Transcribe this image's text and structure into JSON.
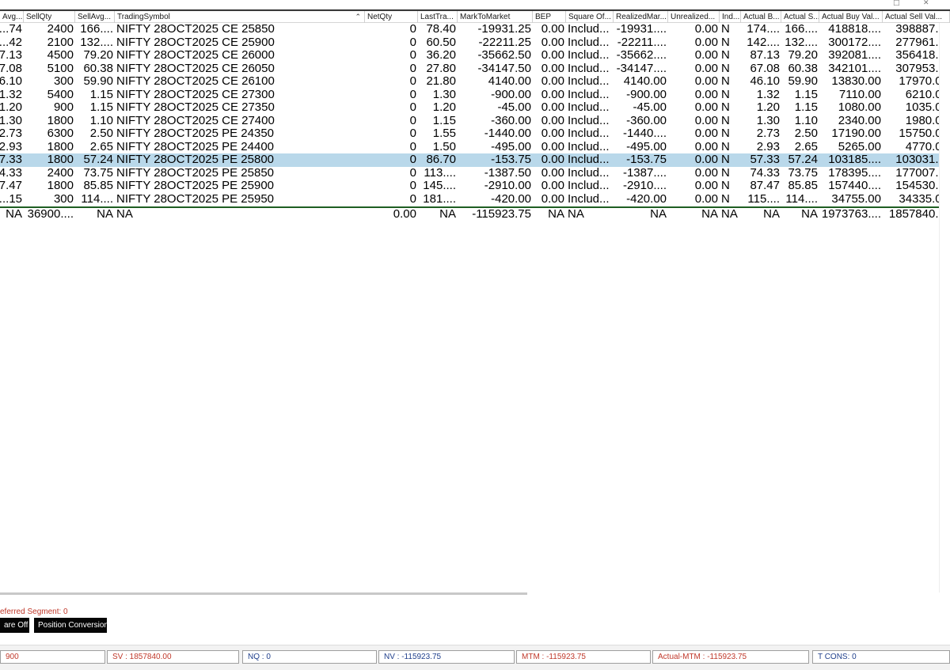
{
  "columns": [
    "Avg...",
    "SellQty",
    "SellAvg...",
    "TradingSymbol",
    "NetQty",
    "LastTra...",
    "MarkToMarket",
    "BEP",
    "Square Of...",
    "RealizedMar...",
    "Unrealized...",
    "Ind...",
    "Actual B...",
    "Actual S...",
    "Actual Buy Val...",
    "Actual Sell Val..."
  ],
  "rows": [
    [
      "74....",
      "2400",
      "166....",
      "NIFTY 28OCT2025 CE 25850",
      "0",
      "78.40",
      "-19931.25",
      "0.00",
      "Includ...",
      "-19931....",
      "0.00",
      "N",
      "174....",
      "166....",
      "418818....",
      "398887...."
    ],
    [
      "42....",
      "2100",
      "132....",
      "NIFTY 28OCT2025 CE 25900",
      "0",
      "60.50",
      "-22211.25",
      "0.00",
      "Includ...",
      "-22211....",
      "0.00",
      "N",
      "142....",
      "132....",
      "300172....",
      "277961...."
    ],
    [
      "7.13",
      "4500",
      "79.20",
      "NIFTY 28OCT2025 CE 26000",
      "0",
      "36.20",
      "-35662.50",
      "0.00",
      "Includ...",
      "-35662....",
      "0.00",
      "N",
      "87.13",
      "79.20",
      "392081....",
      "356418...."
    ],
    [
      "7.08",
      "5100",
      "60.38",
      "NIFTY 28OCT2025 CE 26050",
      "0",
      "27.80",
      "-34147.50",
      "0.00",
      "Includ...",
      "-34147....",
      "0.00",
      "N",
      "67.08",
      "60.38",
      "342101....",
      "307953...."
    ],
    [
      "6.10",
      "300",
      "59.90",
      "NIFTY 28OCT2025 CE 26100",
      "0",
      "21.80",
      "4140.00",
      "0.00",
      "Includ...",
      "4140.00",
      "0.00",
      "N",
      "46.10",
      "59.90",
      "13830.00",
      "17970.00"
    ],
    [
      "1.32",
      "5400",
      "1.15",
      "NIFTY 28OCT2025 CE 27300",
      "0",
      "1.30",
      "-900.00",
      "0.00",
      "Includ...",
      "-900.00",
      "0.00",
      "N",
      "1.32",
      "1.15",
      "7110.00",
      "6210.00"
    ],
    [
      "1.20",
      "900",
      "1.15",
      "NIFTY 28OCT2025 CE 27350",
      "0",
      "1.20",
      "-45.00",
      "0.00",
      "Includ...",
      "-45.00",
      "0.00",
      "N",
      "1.20",
      "1.15",
      "1080.00",
      "1035.00"
    ],
    [
      "1.30",
      "1800",
      "1.10",
      "NIFTY 28OCT2025 CE 27400",
      "0",
      "1.15",
      "-360.00",
      "0.00",
      "Includ...",
      "-360.00",
      "0.00",
      "N",
      "1.30",
      "1.10",
      "2340.00",
      "1980.00"
    ],
    [
      "2.73",
      "6300",
      "2.50",
      "NIFTY 28OCT2025 PE 24350",
      "0",
      "1.55",
      "-1440.00",
      "0.00",
      "Includ...",
      "-1440....",
      "0.00",
      "N",
      "2.73",
      "2.50",
      "17190.00",
      "15750.00"
    ],
    [
      "2.93",
      "1800",
      "2.65",
      "NIFTY 28OCT2025 PE 24400",
      "0",
      "1.50",
      "-495.00",
      "0.00",
      "Includ...",
      "-495.00",
      "0.00",
      "N",
      "2.93",
      "2.65",
      "5265.00",
      "4770.00"
    ],
    [
      "7.33",
      "1800",
      "57.24",
      "NIFTY 28OCT2025 PE 25800",
      "0",
      "86.70",
      "-153.75",
      "0.00",
      "Includ...",
      "-153.75",
      "0.00",
      "N",
      "57.33",
      "57.24",
      "103185....",
      "103031...."
    ],
    [
      "4.33",
      "2400",
      "73.75",
      "NIFTY 28OCT2025 PE 25850",
      "0",
      "113....",
      "-1387.50",
      "0.00",
      "Includ...",
      "-1387....",
      "0.00",
      "N",
      "74.33",
      "73.75",
      "178395....",
      "177007...."
    ],
    [
      "7.47",
      "1800",
      "85.85",
      "NIFTY 28OCT2025 PE 25900",
      "0",
      "145....",
      "-2910.00",
      "0.00",
      "Includ...",
      "-2910....",
      "0.00",
      "N",
      "87.47",
      "85.85",
      "157440....",
      "154530...."
    ],
    [
      "15....",
      "300",
      "114....",
      "NIFTY 28OCT2025 PE 25950",
      "0",
      "181....",
      "-420.00",
      "0.00",
      "Includ...",
      "-420.00",
      "0.00",
      "N",
      "115....",
      "114....",
      "34755.00",
      "34335.00"
    ]
  ],
  "selected_row": 10,
  "total_row": [
    "NA",
    "36900....",
    "NA",
    "NA",
    "0.00",
    "NA",
    "-115923.75",
    "NA",
    "NA",
    "NA",
    "NA",
    "NA",
    "NA",
    "NA",
    "1973763....",
    "1857840...."
  ],
  "deferred_segment": "eferred Segment: 0",
  "buttons": {
    "square_off": "are Off",
    "position_conversion": "Position Conversion"
  },
  "status": {
    "bq": "900",
    "sv": "SV : 1857840.00",
    "nq": "NQ : 0",
    "nv": "NV : -115923.75",
    "mtm": "MTM : -115923.75",
    "actual_mtm": "Actual-MTM : -115923.75",
    "tcons": "T CONS: 0"
  },
  "colors": {
    "selected": "#b9d8ea",
    "total_separator": "#1e5e22",
    "status_red": "#c0392b",
    "status_blue": "#1f3f8c",
    "buttons": "#050505"
  },
  "icons": {
    "restore": "restore-window-icon",
    "close": "close-window-icon",
    "sort": "sort-indicator-icon"
  }
}
